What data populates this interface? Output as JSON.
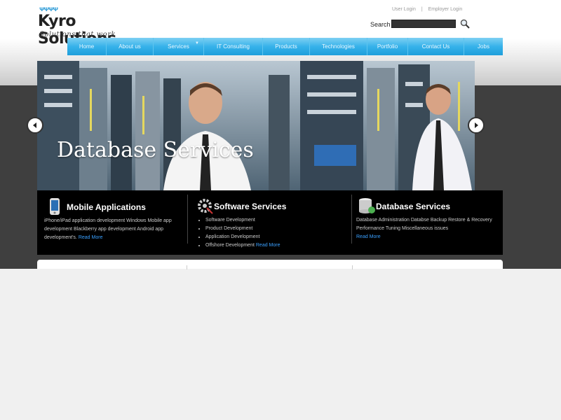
{
  "logo": {
    "title": "Kyro Solutions",
    "tagline": "Solutions that work",
    "people_glyphs": "ᴪᴪᴪᴪ"
  },
  "top_links": {
    "user_login": "User Login",
    "separator": "|",
    "employer_login": "Employer Login"
  },
  "search": {
    "label": "Search",
    "value": ""
  },
  "nav": {
    "items": [
      "Home",
      "About us",
      "Services",
      "IT Consulting",
      "Products",
      "Technologies",
      "Portfolio",
      "Contact Us",
      "Jobs"
    ]
  },
  "slider": {
    "title": "Database Services"
  },
  "services": [
    {
      "title": "Mobile Applications",
      "icon": "phone-icon",
      "text": "iPhone/iPad application development Windows Mobile app development Blackberry app development Android app development's.",
      "read_more": "Read More"
    },
    {
      "title": "Software Services",
      "icon": "gear-icon",
      "bullets": [
        "Software Development",
        "Product Development",
        "Application Development",
        "Offshore Development"
      ],
      "read_more": "Read More"
    },
    {
      "title": "Database Services",
      "icon": "database-icon",
      "text": "Database Administration Databse Backup Restore & Recovery Performance Tuning Miscellaneous issues",
      "read_more": "Read More"
    }
  ],
  "colors": {
    "nav_blue": "#36b2ea",
    "dark_band": "#3f3f3f",
    "link_blue": "#3aa0ff"
  }
}
